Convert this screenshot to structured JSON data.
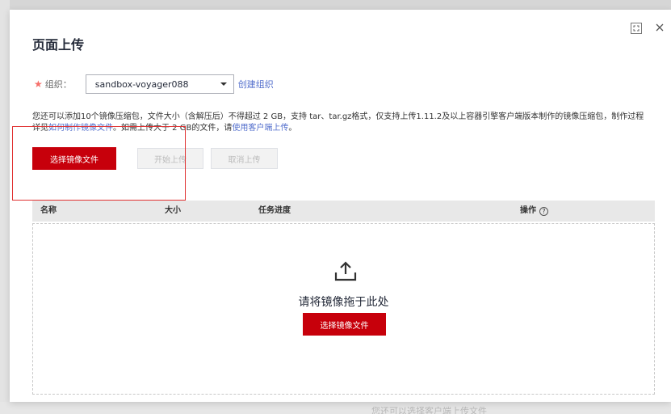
{
  "dialog": {
    "title": "页面上传"
  },
  "organization": {
    "label": "组织：",
    "selected": "sandbox-voyager088",
    "create_link": "创建组织"
  },
  "description": {
    "text_before_link1": "您还可以添加10个镜像压缩包，文件大小（含解压后）不得超过 2 GB，支持 tar、tar.gz格式，仅支持上传1.11.2及以上容器引擎客户端版本制作的镜像压缩包，制作过程详见",
    "link1": "如何制作镜像文件",
    "text_between": "。如需上传大于 2 GB的文件，请",
    "link2": "使用客户端上传",
    "text_end": "。"
  },
  "buttons": {
    "select_file": "选择镜像文件",
    "start_upload": "开始上传",
    "cancel_upload": "取消上传"
  },
  "table": {
    "columns": [
      "名称",
      "大小",
      "任务进度",
      "操作"
    ]
  },
  "dropzone": {
    "text": "请将镜像拖于此处",
    "button": "选择镜像文件"
  },
  "background": {
    "partial_text": "您还可以选择客户端上传文件"
  },
  "colors": {
    "primary": "#c7000b",
    "link": "#526ecc",
    "highlight": "#e03131"
  }
}
